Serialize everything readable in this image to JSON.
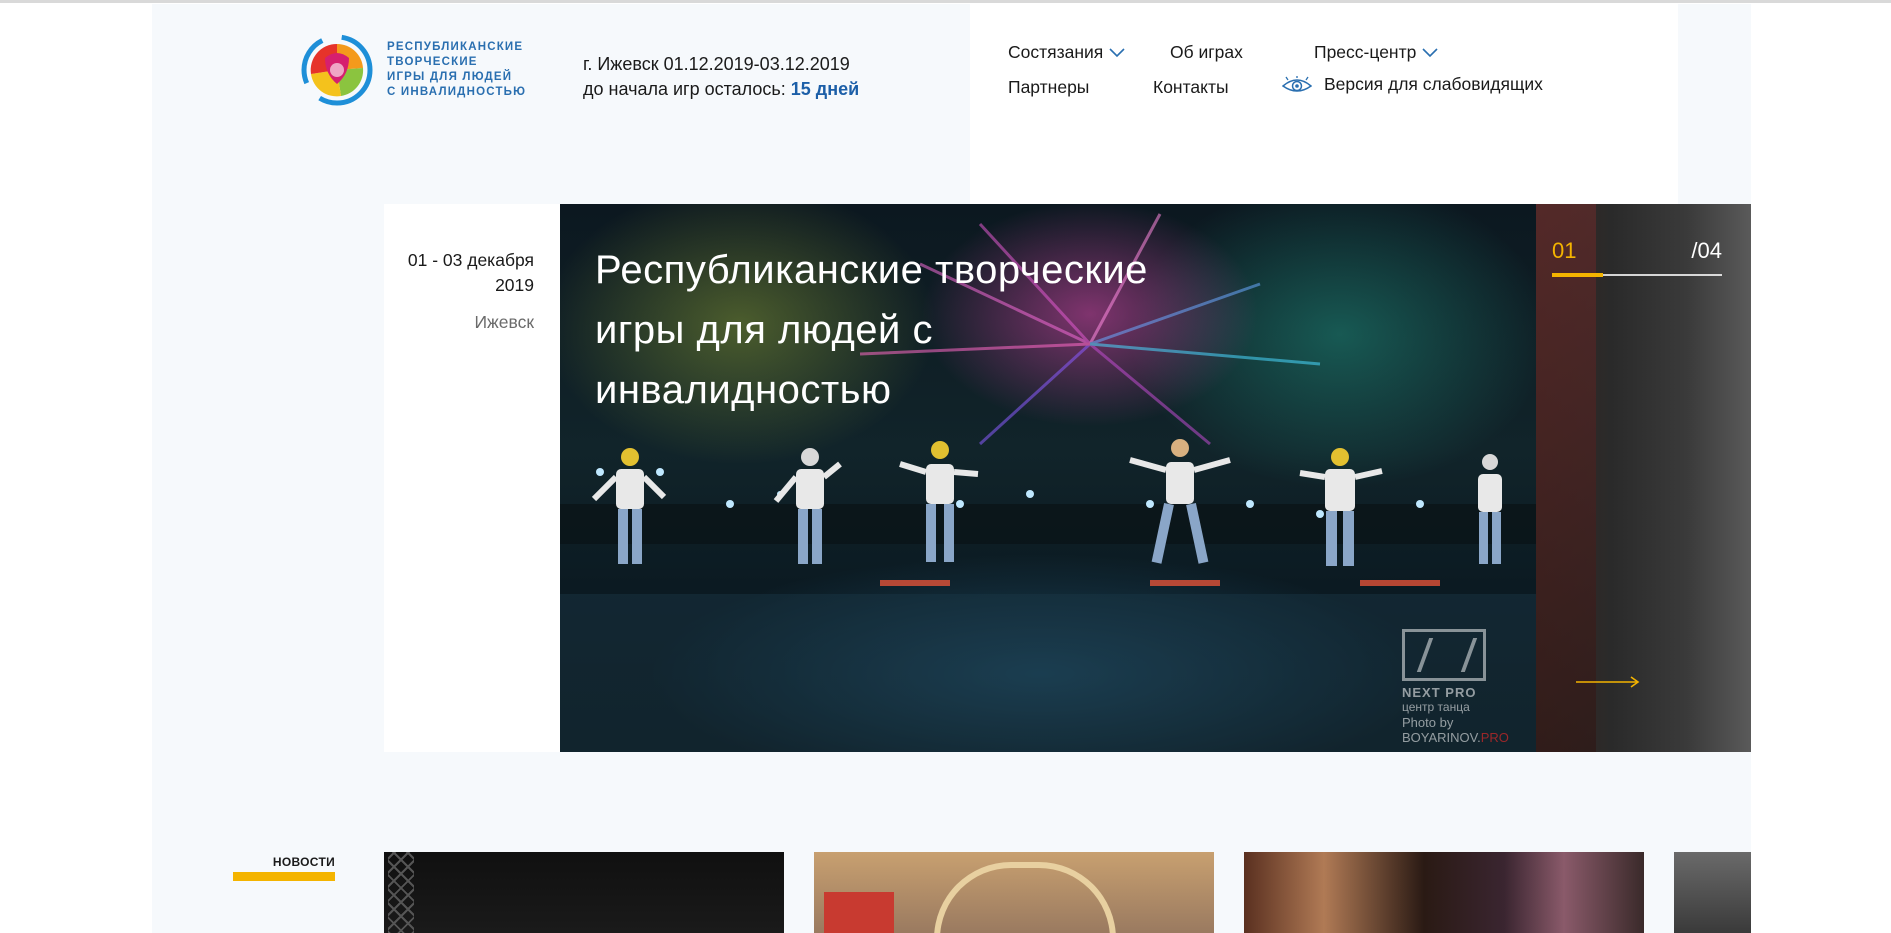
{
  "header": {
    "logo_lines": [
      "РЕСПУБЛИКАНСКИЕ",
      "ТВОРЧЕСКИЕ",
      "ИГРЫ ДЛЯ ЛЮДЕЙ",
      "С ИНВАЛИДНОСТЬЮ"
    ],
    "event_dates": "г. Ижевск 01.12.2019-03.12.2019",
    "countdown_prefix": "до начала игр осталось:",
    "countdown_value": "15 дней"
  },
  "nav": {
    "items": [
      {
        "label": "Состязания",
        "has_dropdown": true
      },
      {
        "label": "Об играх",
        "has_dropdown": false
      },
      {
        "label": "Пресс-центр",
        "has_dropdown": true
      },
      {
        "label": "Партнеры",
        "has_dropdown": false
      },
      {
        "label": "Контакты",
        "has_dropdown": false
      },
      {
        "label": "Версия для слабовидящих",
        "icon": "eye-icon"
      }
    ]
  },
  "hero": {
    "date_line1": "01 - 03 декабря",
    "date_line2": "2019",
    "city": "Ижевск",
    "title": "Республиканские творческие игры для людей с инвалидностью",
    "slide_current": "01",
    "slide_total": "/04",
    "slide_progress": 0.3,
    "watermark": {
      "brand": "NEXT PRO",
      "subtitle": "центр танца",
      "photo_by": "Photo by",
      "author_main": "BOYARINOV.",
      "author_suffix": "PRO"
    }
  },
  "news": {
    "label": "НОВОСТИ"
  },
  "colors": {
    "accent": "#f4b400",
    "link_blue": "#1c5fa8",
    "logo_blue": "#2a6fb0",
    "page_bg": "#f6f9fc"
  }
}
